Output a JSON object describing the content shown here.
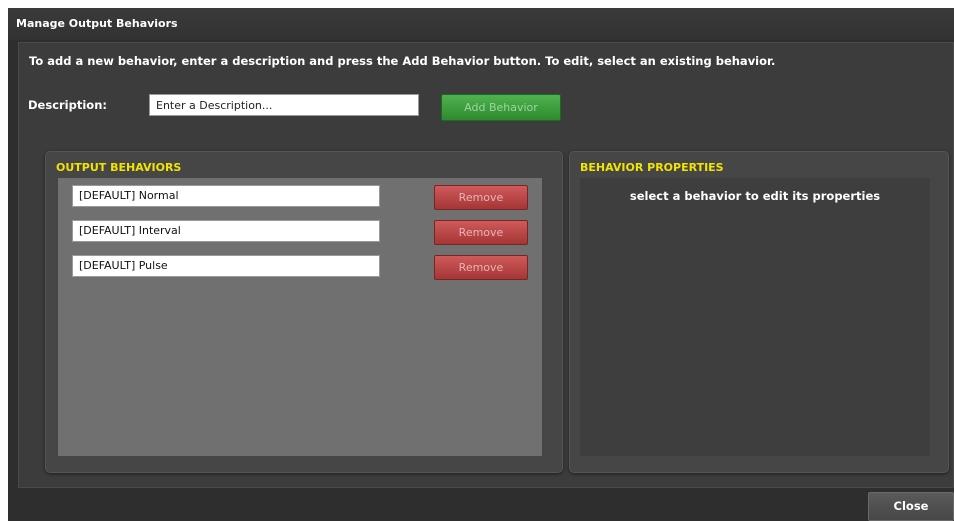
{
  "dialog": {
    "title": "Manage Output Behaviors",
    "instructions": "To add a new behavior, enter a description and press the Add Behavior button. To edit, select an existing behavior.",
    "description_label": "Description:",
    "description_value": "",
    "description_placeholder": "Enter a Description...",
    "add_button_label": "Add Behavior",
    "close_button_label": "Close"
  },
  "output_behaviors": {
    "title": "OUTPUT BEHAVIORS",
    "remove_label": "Remove",
    "items": [
      {
        "label": "[DEFAULT] Normal"
      },
      {
        "label": "[DEFAULT] Interval"
      },
      {
        "label": "[DEFAULT] Pulse"
      }
    ]
  },
  "behavior_properties": {
    "title": "BEHAVIOR PROPERTIES",
    "hint": "select a behavior to edit its properties"
  },
  "colors": {
    "panel_title": "#f2e300",
    "add_button": "#3a9e3a",
    "remove_button": "#b94444",
    "background": "#2e2e2e"
  }
}
